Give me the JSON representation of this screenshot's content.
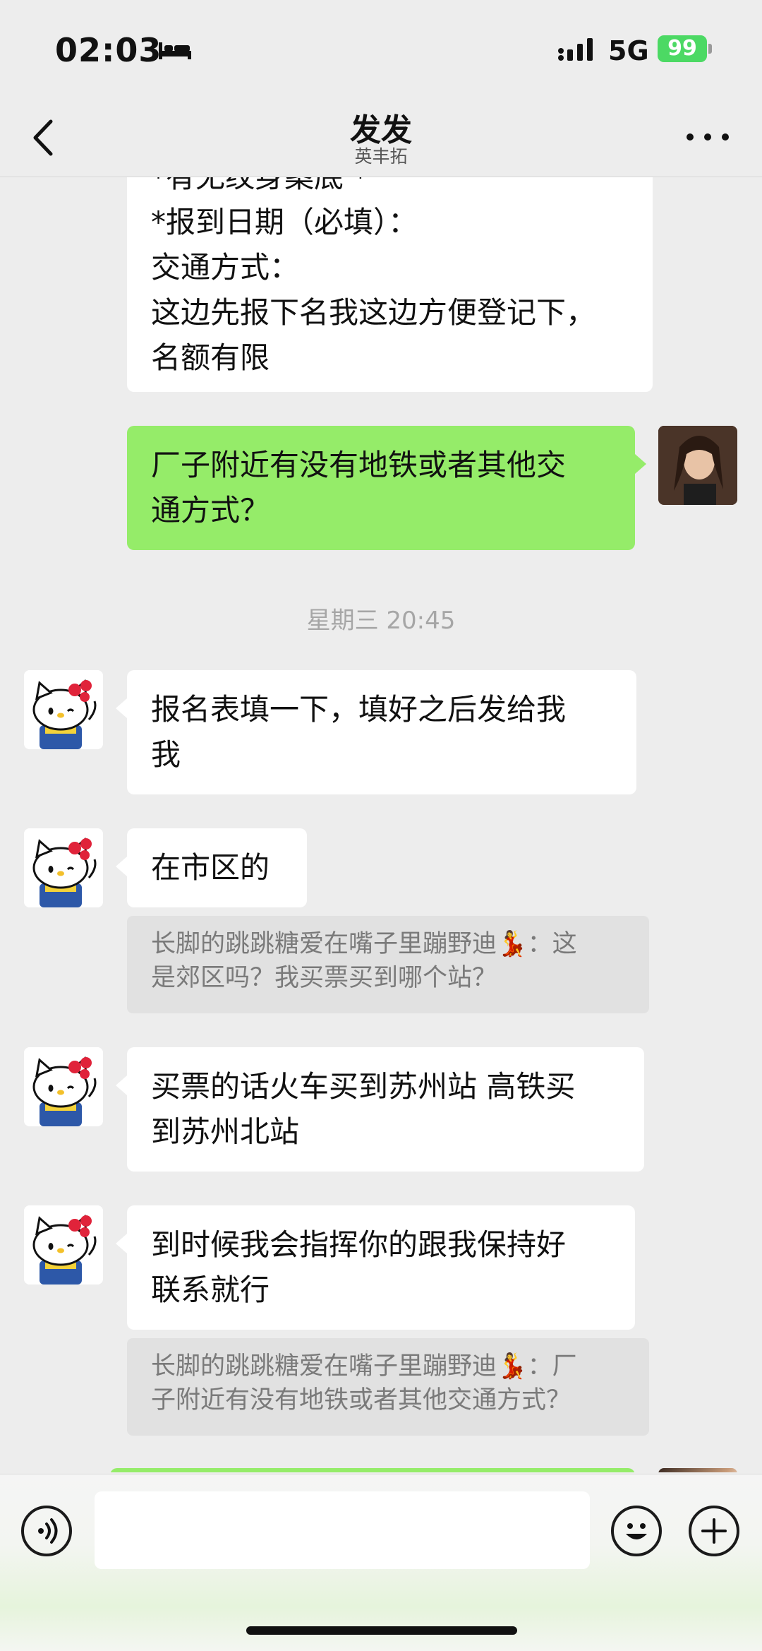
{
  "status_bar": {
    "time": "02:03",
    "network": "5G",
    "battery": "99"
  },
  "nav": {
    "title": "发发",
    "subtitle": "英丰拓"
  },
  "messages": {
    "m0_text": "*有无纹身案底 *\n*报到日期（必填）：\n交通方式：\n这边先报下名我这边方便登记下，\n名额有限",
    "m1_text": "厂子附近有没有地铁或者其他交\n通方式？",
    "time_sep": "星期三 20:45",
    "m2_text": "报名表填一下，填好之后发给我\n我",
    "m3_text": "在市区的",
    "m3_quote": "长脚的跳跳糖爱在嘴子里蹦野迪💃：这\n是郊区吗？我买票买到哪个站？",
    "m4_text": "买票的话火车买到苏州站 高铁买\n到苏州北站",
    "m5_text": "到时候我会指挥你的跟我保持好\n联系就行",
    "m5_quote": "长脚的跳跳糖爱在嘴子里蹦野迪💃：厂\n子附近有没有地铁或者其他交通方式？"
  },
  "icons": {
    "back": "chevron-left-icon",
    "more": "more-dots-icon",
    "voice": "voice-icon",
    "emoji": "emoji-icon",
    "plus": "plus-icon",
    "avatar_contact": "hello-kitty-avatar",
    "avatar_self": "photo-avatar"
  },
  "colors": {
    "bubble_self": "#95ec69",
    "bubble_other": "#ffffff",
    "quote_bg": "#e1e1e1",
    "background": "#ededed"
  }
}
